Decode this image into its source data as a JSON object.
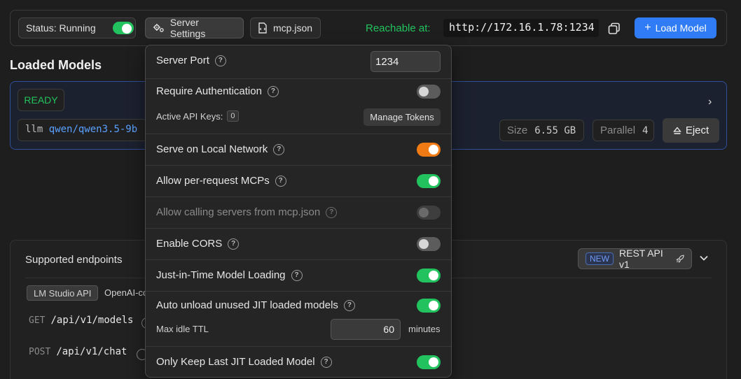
{
  "topbar": {
    "status_label": "Status: Running",
    "server_settings_label": "Server Settings",
    "mcp_label": "mcp.json",
    "reachable_label": "Reachable at:",
    "url": "http://172.16.1.78:1234",
    "load_model_label": "Load Model"
  },
  "loaded_models": {
    "title": "Loaded Models",
    "badge": "READY",
    "model_keyword": "llm",
    "model_id": "qwen/qwen3.5-9b",
    "size_label": "Size",
    "size_value": "6.55 GB",
    "parallel_label": "Parallel",
    "parallel_value": "4",
    "eject_label": "Eject"
  },
  "endpoints": {
    "title": "Supported endpoints",
    "new_badge": "NEW",
    "rest_label": "REST API v1",
    "tabs": [
      "LM Studio API",
      "OpenAI-compatible"
    ],
    "rows": [
      {
        "method": "GET",
        "path": "/api/v1/models"
      },
      {
        "method": "POST",
        "path": "/api/v1/chat"
      }
    ]
  },
  "settings": {
    "server_port_label": "Server Port",
    "server_port_value": "1234",
    "require_auth_label": "Require Authentication",
    "active_keys_label": "Active API Keys:",
    "active_keys_count": "0",
    "manage_tokens_label": "Manage Tokens",
    "local_network_label": "Serve on Local Network",
    "per_request_mcps_label": "Allow per-request MCPs",
    "calling_servers_label": "Allow calling servers from mcp.json",
    "cors_label": "Enable CORS",
    "jit_label": "Just-in-Time Model Loading",
    "auto_unload_label": "Auto unload unused JIT loaded models",
    "max_idle_label": "Max idle TTL",
    "max_idle_value": "60",
    "max_idle_unit": "minutes",
    "keep_last_label": "Only Keep Last JIT Loaded Model"
  },
  "colors": {
    "accent_blue": "#2f7cf6",
    "toggle_green": "#22c35e",
    "toggle_orange": "#f07a13"
  }
}
